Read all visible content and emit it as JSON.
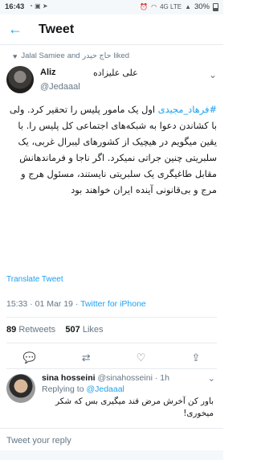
{
  "status_bar": {
    "time": "16:43",
    "battery": "30%",
    "signal_label": "4G LTE",
    "icons": [
      "whatsapp-icon",
      "image-icon",
      "telegram-icon",
      "alarm-icon",
      "wifi-icon",
      "signal-icon",
      "battery-icon"
    ]
  },
  "header": {
    "title": "Tweet"
  },
  "liked_by": {
    "name_1": "Jalal Samiee",
    "conjunction": "and",
    "name_2": "حاج حیدر",
    "suffix": "liked"
  },
  "tweet": {
    "author_name": "Aliz",
    "author_name_fa": "علی علیزاده",
    "handle": "@Jedaaal",
    "hashtag": "#فرهاد_مجیدی",
    "text_rest": " اول یک مامور پلیس را تحقیر کرد. ولی با کشاندن دعوا به شبکه‌های اجتماعی کل پلیس را. با یقین میگویم در هیچیک از کشورهای لیبرال غربی، یک سلبریتی چنین جراتی نمیکرد. اگر ناجا و فرماندهانش مقابل طاغیگری یک سلبریتی نایستند، مسئول هرج و مرج و بی‌قانونی آینده ایران خواهند بود",
    "translate_label": "Translate Tweet",
    "time": "15:33",
    "date": "01 Mar 19",
    "source": "Twitter for iPhone",
    "retweets": "89",
    "retweets_label": "Retweets",
    "likes": "507",
    "likes_label": "Likes"
  },
  "reply": {
    "name": "sina hosseini",
    "handle": "@sinahosseini",
    "age": "1h",
    "replying_to_label": "Replying to",
    "replying_to": "@Jedaaal",
    "text": "باور کن آخرش مرض قند میگیری بس که شکر میخوری!"
  },
  "composer": {
    "placeholder": "Tweet your reply"
  }
}
